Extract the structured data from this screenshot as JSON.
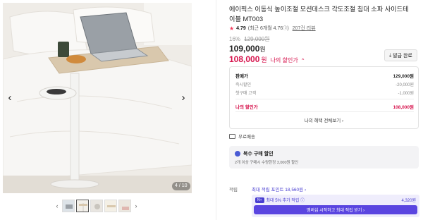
{
  "gallery": {
    "page_indicator": "4 / 10",
    "prev_arrow": "‹",
    "next_arrow": "›",
    "thumb_prev": "‹",
    "thumb_next": "›",
    "thumb_count": 5,
    "active_thumb": 1
  },
  "product": {
    "title": "에이픽스 이동식 높이조절 모션데스크 각도조절 침대 소파 사이드테이블 MT003",
    "rating": "4.79",
    "rating_recent": "(최근 6개월 4.76",
    "review_count": "207건 리뷰",
    "discount_percent": "16%",
    "original_price": "129,000원",
    "price": "109,000",
    "price_unit": "원",
    "my_price": "108,000",
    "my_price_unit": "원",
    "my_price_label": "나의 할인가",
    "coupon_button": "발급 완료"
  },
  "price_breakdown": {
    "rows": [
      {
        "label": "판매가",
        "value": "129,000원"
      },
      {
        "label": "즉시할인",
        "value": "-20,000원"
      },
      {
        "label": "첫구매 고객",
        "value": "-1,000원"
      },
      {
        "label": "나의 할인가",
        "value": "108,000원"
      }
    ],
    "more_link": "나의 혜택 전체보기 ›"
  },
  "shipping": {
    "label": "무료배송"
  },
  "bulk": {
    "title": "복수 구매 할인",
    "description": "2개 이상 구매시 수량한정 3,000원 할인"
  },
  "points": {
    "label": "적립",
    "max_text": "최대 적립 포인트 18,560원 ›",
    "membership_badge": "N+",
    "membership_text": "최대 5% 추가 적립 ⓘ",
    "membership_amount": "4,320원",
    "membership_button": "멤버십 시작하고 최대 적립 받기 ›"
  },
  "colors": {
    "accent_red": "#d6114b",
    "accent_purple": "#4a3fd1",
    "star": "#f23a5c"
  }
}
